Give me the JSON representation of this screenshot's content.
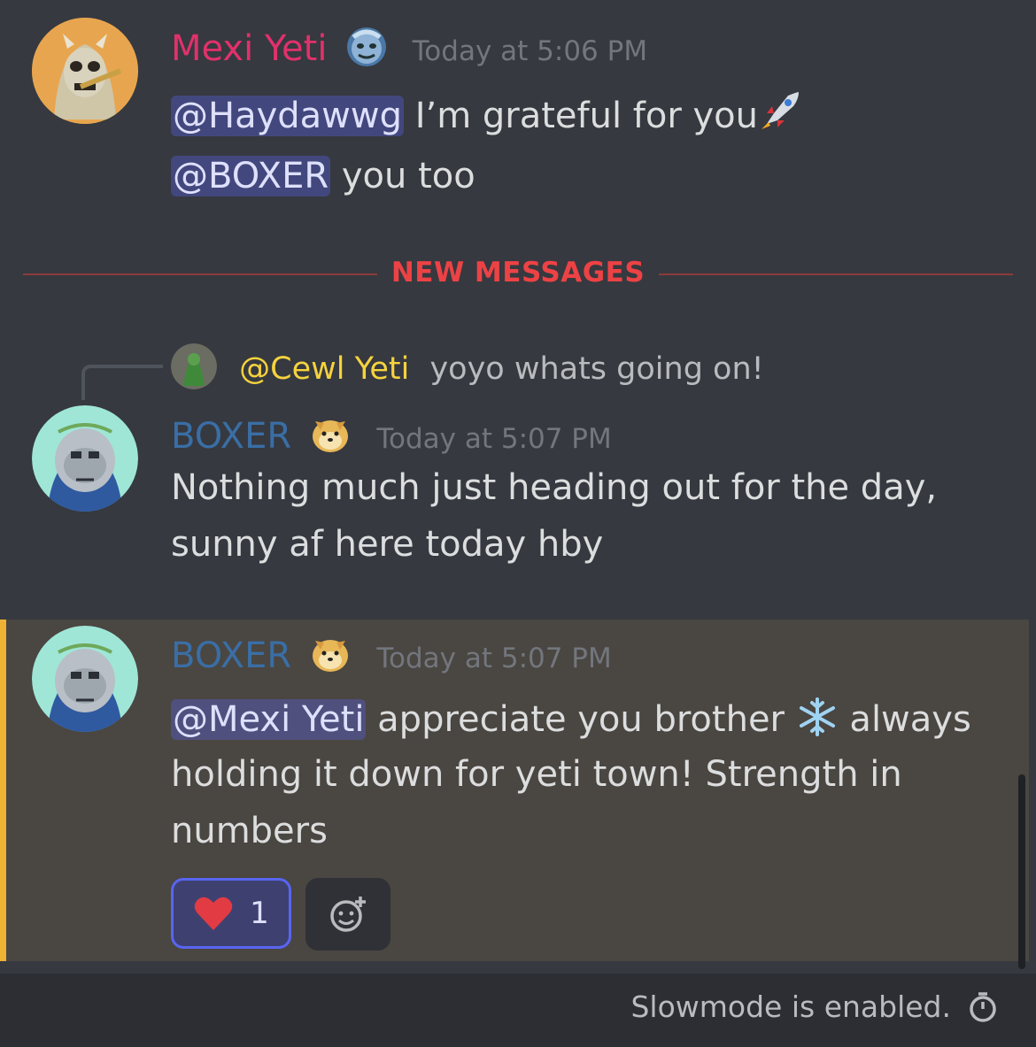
{
  "messages": [
    {
      "username": "Mexi Yeti",
      "username_color": "#e0316b",
      "timestamp": "Today at 5:06 PM",
      "badge_icon": "yeti-face-emoji",
      "lines": [
        {
          "mention": "@Haydawwg",
          "text": " I’m grateful for you"
        },
        {
          "mention": "@BOXER",
          "text": " you too"
        }
      ]
    }
  ],
  "divider": {
    "label": "NEW MESSAGES",
    "color": "#ed4245"
  },
  "reply": {
    "mention": "@Cewl Yeti",
    "mention_color": "#f5d33d",
    "text": "yoyo whats going on!"
  },
  "boxer_1": {
    "username": "BOXER",
    "username_color": "#3a6ea5",
    "timestamp": "Today at 5:07 PM",
    "badge_icon": "doge-emoji",
    "line1": "Nothing much just heading out for the day,",
    "line2": "sunny af here today hby"
  },
  "boxer_2": {
    "username": "BOXER",
    "username_color": "#3a6ea5",
    "timestamp": "Today at 5:07 PM",
    "badge_icon": "doge-emoji",
    "mention": "@Mexi Yeti",
    "line1_rest": " appreciate you brother",
    "line1_tail": " always",
    "line2": "holding it down for yeti town! Strength in",
    "line3": "numbers",
    "highlight_color": "#f0b232"
  },
  "reaction": {
    "emoji": "heart",
    "count": "1"
  },
  "footer": {
    "text": "Slowmode is enabled."
  }
}
